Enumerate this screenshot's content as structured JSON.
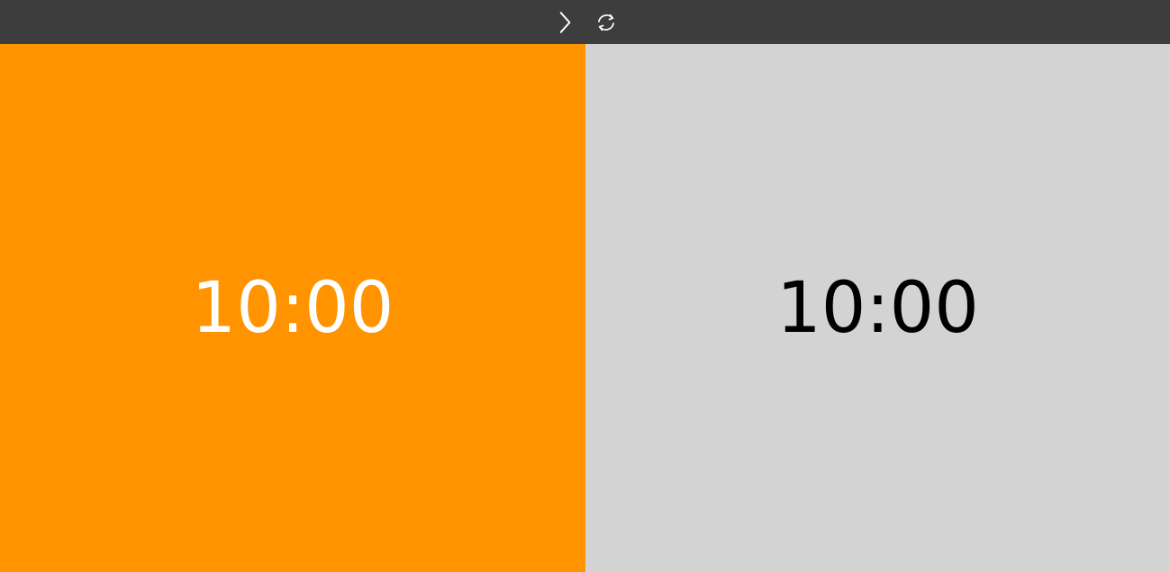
{
  "toolbar": {
    "next_icon": "chevron-right-icon",
    "reset_icon": "refresh-icon",
    "background": "#3d3d3d"
  },
  "players": [
    {
      "time": "10:00",
      "background": "#ff9300",
      "text_color": "#ffffff"
    },
    {
      "time": "10:00",
      "background": "#d3d3d3",
      "text_color": "#000000"
    }
  ]
}
